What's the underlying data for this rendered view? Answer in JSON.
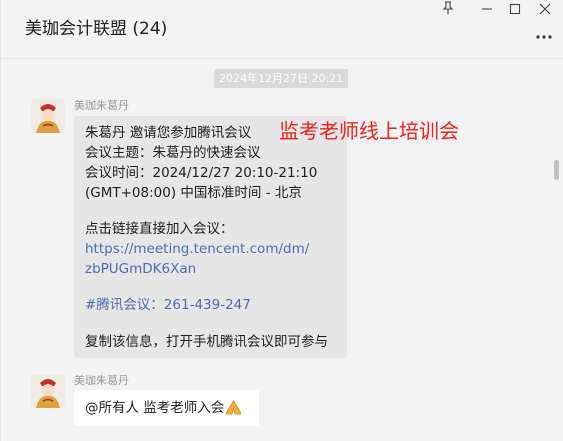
{
  "window": {
    "title": "美珈会计联盟 (24)",
    "icons": [
      "pin-icon",
      "minimize-icon",
      "maximize-icon",
      "close-icon",
      "more-icon"
    ]
  },
  "timestamp": "2024年12月27日 20:21",
  "messages": [
    {
      "sender": "美珈朱葛丹",
      "lines": [
        "朱葛丹 邀请您参加腾讯会议",
        "会议主题：朱葛丹的快速会议",
        "会议时间：2024/12/27 20:10-21:10",
        "(GMT+08:00) 中国标准时间 - 北京",
        "",
        "点击链接直接加入会议：",
        "https://meeting.tencent.com/dm/",
        "zbPUGmDK6Xan",
        "",
        "#腾讯会议：261-439-247",
        "",
        "复制该信息，打开手机腾讯会议即可参与"
      ]
    },
    {
      "sender": "美珈朱葛丹",
      "text": "@所有人 监考老师入会"
    }
  ],
  "annotation": "监考老师线上培训会",
  "colors": {
    "annotation": "#f01e1e",
    "link": "#4d6ea8",
    "bubble_incoming": "#e6e6e6",
    "chat_background": "#f3f3f3"
  }
}
